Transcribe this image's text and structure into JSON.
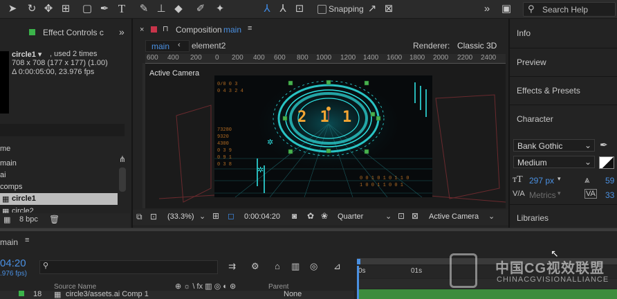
{
  "toolbar": {
    "tools": [
      "rotate-icon",
      "camera-orbit-icon",
      "pan-behind-icon",
      "rectangle-tool-icon",
      "pen-tool-icon",
      "type-tool-icon",
      "brush-tool-icon",
      "clone-stamp-icon",
      "eraser-tool-icon",
      "roto-brush-icon",
      "puppet-pin-icon",
      "local-axis-icon",
      "world-axis-icon",
      "view-axis-icon"
    ],
    "snapping_label": "Snapping",
    "search_placeholder": "Search Help"
  },
  "left_panel": {
    "tab_label": "Effect Controls c",
    "asset_name": "circle1 ▾",
    "asset_used": ", used 2 times",
    "asset_dims": "708 x 708  (177 x 177) (1.00)",
    "asset_duration": "Δ 0:00:05:00, 23.976 fps",
    "column_header": "me",
    "items": [
      "main",
      "ai",
      "comps",
      "circle1",
      "circle2"
    ],
    "bpc_label": "8 bpc"
  },
  "composition": {
    "tab_label": "Composition",
    "tab_name": "main",
    "breadcrumb_current": "main",
    "breadcrumb_next": "element2",
    "renderer_label": "Renderer:",
    "renderer_value": "Classic 3D",
    "ruler_ticks": [
      "600",
      "400",
      "200",
      "0",
      "200",
      "400",
      "600",
      "800",
      "1000",
      "1200",
      "1400",
      "1600",
      "1800",
      "2000",
      "2200",
      "2400"
    ],
    "active_camera_label": "Active Camera",
    "hud_digits": "2 1 1",
    "zoom": "(33.3%)",
    "timecode": "0:00:04:20",
    "resolution": "Quarter",
    "view": "Active Camera"
  },
  "right_panel": {
    "items": [
      "Info",
      "Preview",
      "Effects & Presets",
      "Character",
      "Libraries"
    ],
    "font_family": "Bank Gothic",
    "font_style": "Medium",
    "font_size": "297 px",
    "kerning": "Metrics",
    "leading": "59",
    "tracking": "33"
  },
  "timeline": {
    "tab_label": "main",
    "timecode": "04:20",
    "fps": ".976 fps)",
    "col_source": "Source Name",
    "col_parent": "Parent",
    "layer_num": "18",
    "layer_name": "circle3/assets.ai Comp 1",
    "parent_value": "None",
    "ruler": [
      "0s",
      "01s"
    ]
  },
  "watermark": {
    "cn": "中国CG视效联盟",
    "en": "CHINACGVISIONALLIANCE"
  },
  "colors": {
    "accent": "#4a90e2",
    "panel_bg": "#232323",
    "highlight": "#bdbdbd",
    "hud_cyan": "#2fe3e3",
    "hud_orange": "#f3a533"
  }
}
